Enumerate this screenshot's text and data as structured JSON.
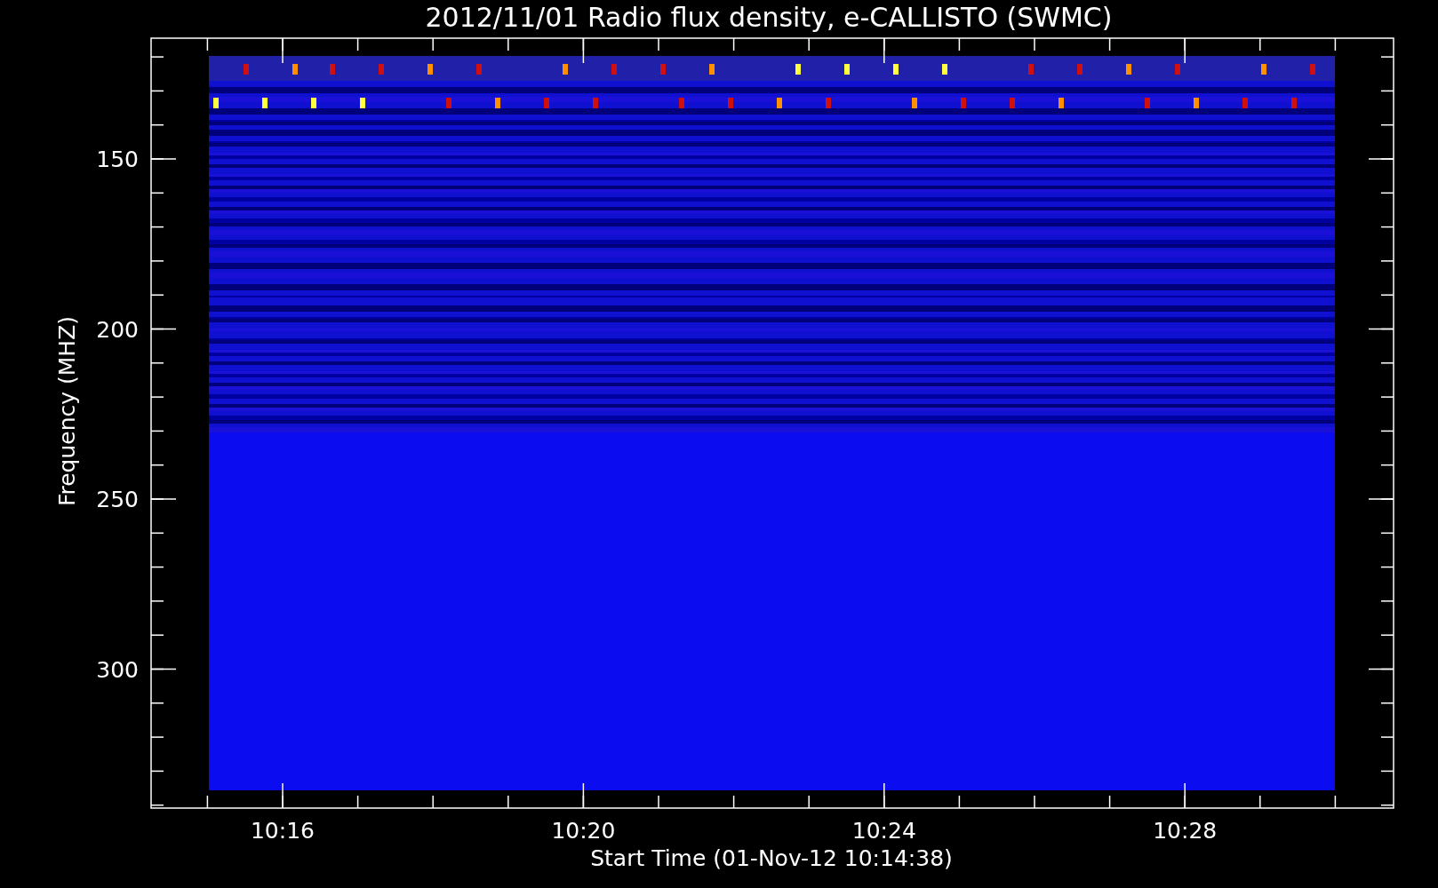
{
  "title": "2012/11/01  Radio flux density, e-CALLISTO (SWMC)",
  "ylabel": "Frequency (MHZ)",
  "xlabel": "Start Time (01-Nov-12 10:14:38)",
  "yticks": [
    "150",
    "200",
    "250",
    "300"
  ],
  "xticks": [
    "10:16",
    "10:20",
    "10:24",
    "10:28"
  ]
}
